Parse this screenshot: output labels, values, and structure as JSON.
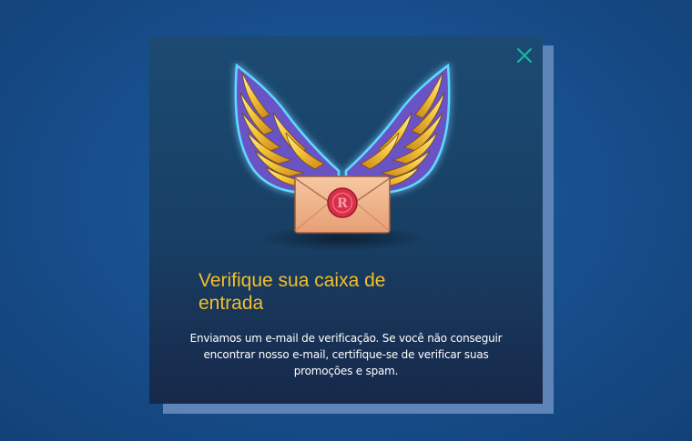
{
  "dialog": {
    "title": "Verifique sua caixa de entrada",
    "message": "Enviamos um e-mail de verificação. Se você não conseguir encontrar nosso e-mail, certifique-se de verificar suas promoções e spam.",
    "close_icon": "close-icon",
    "illustration_icon": "winged-envelope-icon",
    "seal_letter": "R"
  },
  "colors": {
    "page_background": "#18508f",
    "modal_background": "#1c4a72",
    "title": "#f2be2a",
    "text": "#ffffff",
    "close": "#1fb5a6",
    "wing_gold": "#f4c53a",
    "wing_purple": "#6a53c4",
    "envelope": "#f0b58c",
    "seal": "#d8304a"
  }
}
